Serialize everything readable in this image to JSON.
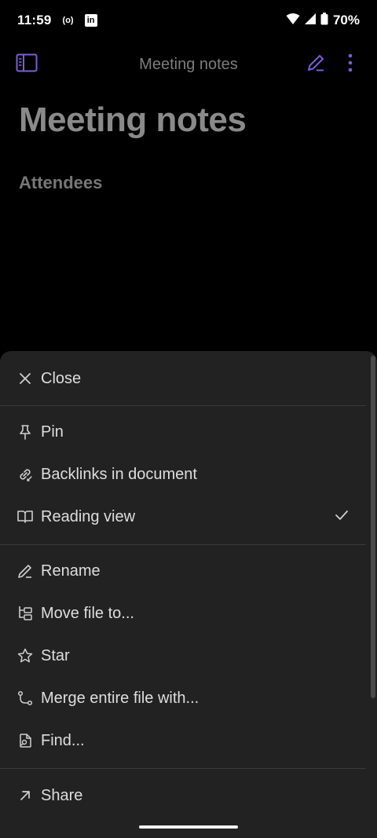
{
  "status_bar": {
    "time": "11:59",
    "hotspot_text": "(o)",
    "linkedin_text": "in",
    "battery": "70%"
  },
  "header": {
    "title": "Meeting notes"
  },
  "note": {
    "title": "Meeting notes",
    "heading": "Attendees"
  },
  "menu": {
    "close": "Close",
    "pin": "Pin",
    "backlinks": "Backlinks in document",
    "reading_view": "Reading view",
    "rename": "Rename",
    "move_file": "Move file to...",
    "star": "Star",
    "merge": "Merge entire file with...",
    "find": "Find...",
    "share": "Share"
  },
  "colors": {
    "accent": "#7c5cd6",
    "sheet_bg": "#222222",
    "background": "#000000"
  }
}
